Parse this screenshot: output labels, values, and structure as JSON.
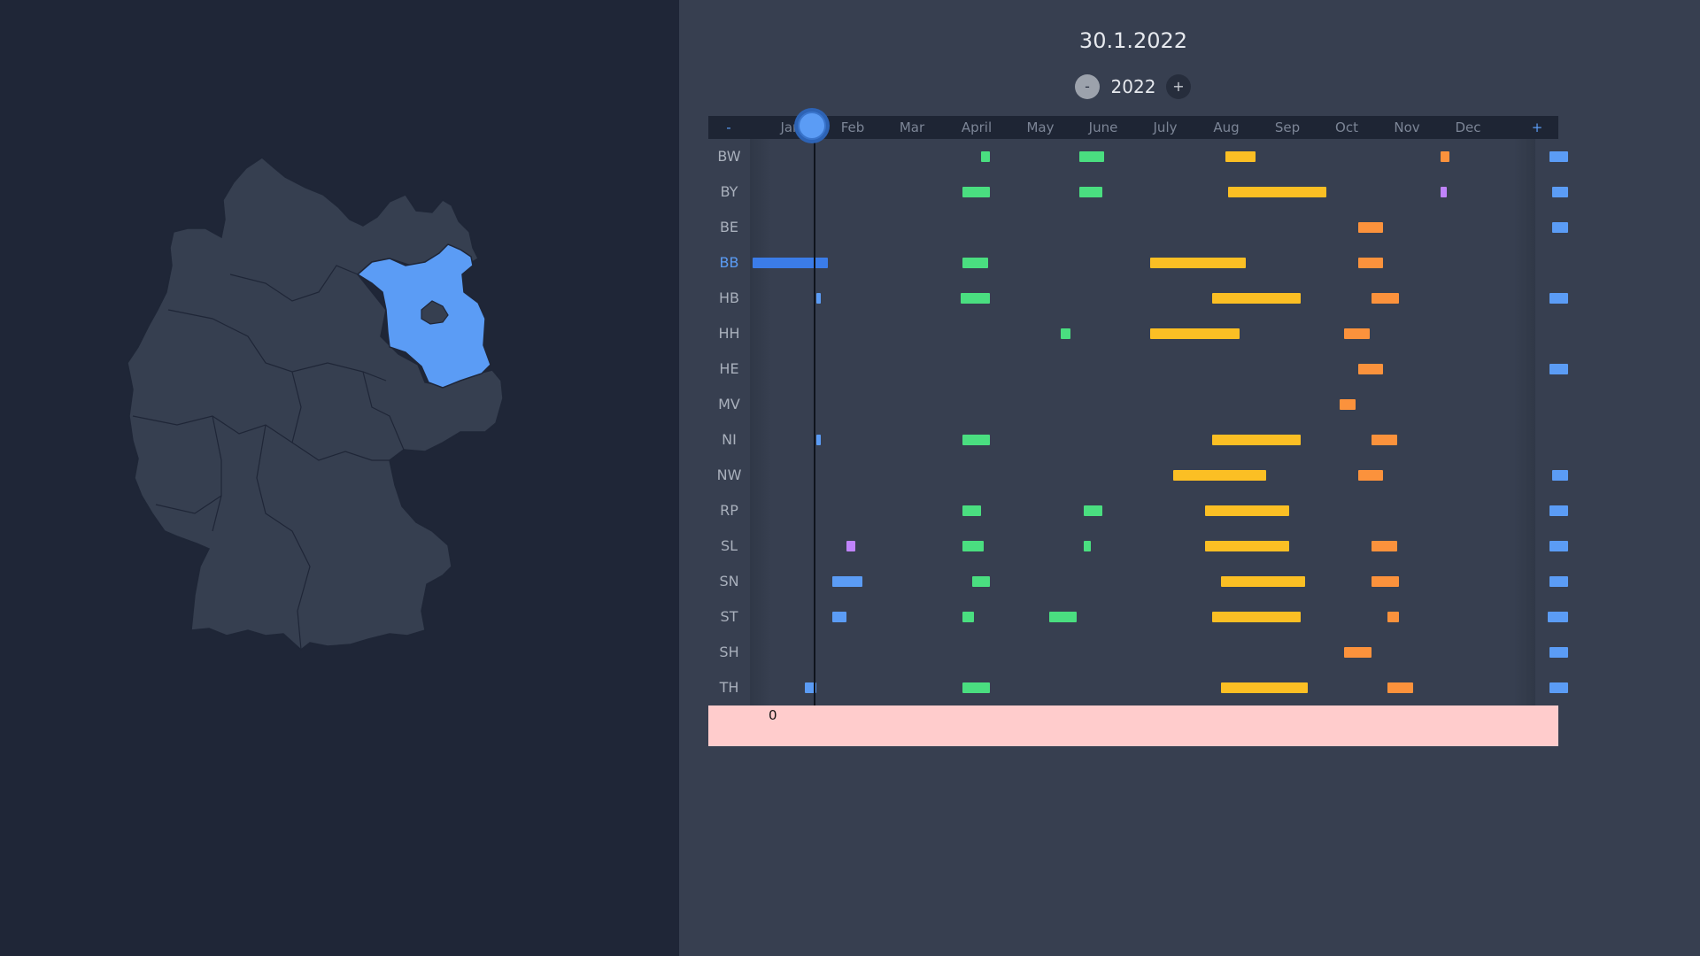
{
  "date_title": "30.1.2022",
  "year": {
    "minus_label": "-",
    "value": "2022",
    "plus_label": "+"
  },
  "timeline": {
    "zoom_out_label": "-",
    "zoom_in_label": "+",
    "months": [
      "Jan",
      "Feb",
      "Mar",
      "April",
      "May",
      "June",
      "July",
      "Aug",
      "Sep",
      "Oct",
      "Nov",
      "Dec"
    ],
    "cursor_day": 30
  },
  "selected_state": "BB",
  "counter": "0",
  "legend_colors": {
    "winter": "#5b9cf5",
    "winter_selected": "#3b7ce8",
    "easter": "#4ade80",
    "summer": "#fbbf24",
    "autumn": "#fb923c",
    "other": "#c084fc"
  },
  "states": [
    {
      "code": "BW",
      "bars": [
        {
          "start": 101,
          "end": 104,
          "kind": "easter"
        },
        {
          "start": 144,
          "end": 154,
          "kind": "easter"
        },
        {
          "start": 208,
          "end": 220,
          "kind": "summer"
        },
        {
          "start": 302,
          "end": 305,
          "kind": "autumn"
        },
        {
          "start": 350,
          "end": 357,
          "kind": "winter"
        }
      ]
    },
    {
      "code": "BY",
      "bars": [
        {
          "start": 93,
          "end": 104,
          "kind": "easter"
        },
        {
          "start": 144,
          "end": 153,
          "kind": "easter"
        },
        {
          "start": 209,
          "end": 251,
          "kind": "summer"
        },
        {
          "start": 302,
          "end": 304,
          "kind": "other"
        },
        {
          "start": 351,
          "end": 357,
          "kind": "winter"
        }
      ]
    },
    {
      "code": "BE",
      "bars": [
        {
          "start": 266,
          "end": 276,
          "kind": "autumn"
        },
        {
          "start": 351,
          "end": 357,
          "kind": "winter"
        }
      ]
    },
    {
      "code": "BB",
      "bars": [
        {
          "start": 1,
          "end": 33,
          "kind": "winter_selected"
        },
        {
          "start": 93,
          "end": 103,
          "kind": "easter"
        },
        {
          "start": 175,
          "end": 216,
          "kind": "summer"
        },
        {
          "start": 266,
          "end": 276,
          "kind": "autumn"
        }
      ]
    },
    {
      "code": "HB",
      "bars": [
        {
          "start": 29,
          "end": 30,
          "kind": "winter"
        },
        {
          "start": 92,
          "end": 104,
          "kind": "easter"
        },
        {
          "start": 202,
          "end": 240,
          "kind": "summer"
        },
        {
          "start": 272,
          "end": 283,
          "kind": "autumn"
        },
        {
          "start": 350,
          "end": 357,
          "kind": "winter"
        }
      ]
    },
    {
      "code": "HH",
      "bars": [
        {
          "start": 136,
          "end": 139,
          "kind": "easter"
        },
        {
          "start": 175,
          "end": 213,
          "kind": "summer"
        },
        {
          "start": 260,
          "end": 270,
          "kind": "autumn"
        }
      ]
    },
    {
      "code": "HE",
      "bars": [
        {
          "start": 266,
          "end": 276,
          "kind": "autumn"
        },
        {
          "start": 350,
          "end": 357,
          "kind": "winter"
        }
      ]
    },
    {
      "code": "MV",
      "bars": [
        {
          "start": 258,
          "end": 264,
          "kind": "autumn"
        }
      ]
    },
    {
      "code": "NI",
      "bars": [
        {
          "start": 29,
          "end": 30,
          "kind": "winter"
        },
        {
          "start": 93,
          "end": 104,
          "kind": "easter"
        },
        {
          "start": 202,
          "end": 240,
          "kind": "summer"
        },
        {
          "start": 272,
          "end": 282,
          "kind": "autumn"
        }
      ]
    },
    {
      "code": "NW",
      "bars": [
        {
          "start": 185,
          "end": 225,
          "kind": "summer"
        },
        {
          "start": 266,
          "end": 276,
          "kind": "autumn"
        },
        {
          "start": 351,
          "end": 357,
          "kind": "winter"
        }
      ]
    },
    {
      "code": "RP",
      "bars": [
        {
          "start": 93,
          "end": 100,
          "kind": "easter"
        },
        {
          "start": 146,
          "end": 153,
          "kind": "easter"
        },
        {
          "start": 199,
          "end": 235,
          "kind": "summer"
        },
        {
          "start": 350,
          "end": 357,
          "kind": "winter"
        }
      ]
    },
    {
      "code": "SL",
      "bars": [
        {
          "start": 42,
          "end": 45,
          "kind": "other"
        },
        {
          "start": 93,
          "end": 101,
          "kind": "easter"
        },
        {
          "start": 146,
          "end": 148,
          "kind": "easter"
        },
        {
          "start": 199,
          "end": 235,
          "kind": "summer"
        },
        {
          "start": 272,
          "end": 282,
          "kind": "autumn"
        },
        {
          "start": 350,
          "end": 357,
          "kind": "winter"
        }
      ]
    },
    {
      "code": "SN",
      "bars": [
        {
          "start": 36,
          "end": 48,
          "kind": "winter"
        },
        {
          "start": 97,
          "end": 104,
          "kind": "easter"
        },
        {
          "start": 206,
          "end": 242,
          "kind": "summer"
        },
        {
          "start": 272,
          "end": 283,
          "kind": "autumn"
        },
        {
          "start": 350,
          "end": 357,
          "kind": "winter"
        }
      ]
    },
    {
      "code": "ST",
      "bars": [
        {
          "start": 36,
          "end": 41,
          "kind": "winter"
        },
        {
          "start": 93,
          "end": 97,
          "kind": "easter"
        },
        {
          "start": 131,
          "end": 142,
          "kind": "easter"
        },
        {
          "start": 202,
          "end": 240,
          "kind": "summer"
        },
        {
          "start": 279,
          "end": 283,
          "kind": "autumn"
        },
        {
          "start": 349,
          "end": 357,
          "kind": "winter"
        }
      ]
    },
    {
      "code": "SH",
      "bars": [
        {
          "start": 260,
          "end": 271,
          "kind": "autumn"
        },
        {
          "start": 350,
          "end": 357,
          "kind": "winter"
        }
      ]
    },
    {
      "code": "TH",
      "bars": [
        {
          "start": 24,
          "end": 28,
          "kind": "winter"
        },
        {
          "start": 93,
          "end": 104,
          "kind": "easter"
        },
        {
          "start": 206,
          "end": 243,
          "kind": "summer"
        },
        {
          "start": 279,
          "end": 289,
          "kind": "autumn"
        },
        {
          "start": 350,
          "end": 357,
          "kind": "winter"
        }
      ]
    }
  ]
}
